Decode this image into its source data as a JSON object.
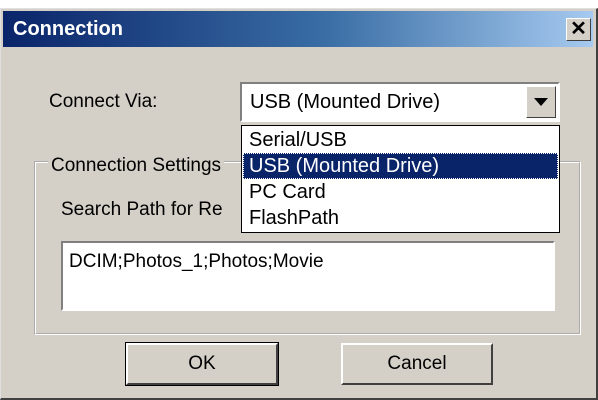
{
  "dialog": {
    "title": "Connection",
    "close_glyph": "✕"
  },
  "connect_via": {
    "label": "Connect Via:",
    "selected": "USB (Mounted Drive)",
    "options": [
      "Serial/USB",
      "USB (Mounted Drive)",
      "PC Card",
      "FlashPath"
    ],
    "highlighted_index": 1
  },
  "settings": {
    "group_label": "Connection Settings",
    "search_label": "Search Path for Re",
    "search_value": "DCIM;Photos_1;Photos;Movie"
  },
  "buttons": {
    "ok": "OK",
    "cancel": "Cancel"
  },
  "colors": {
    "title_bar": "#0a246a",
    "selection": "#0a246a",
    "face": "#d4d0c8"
  }
}
